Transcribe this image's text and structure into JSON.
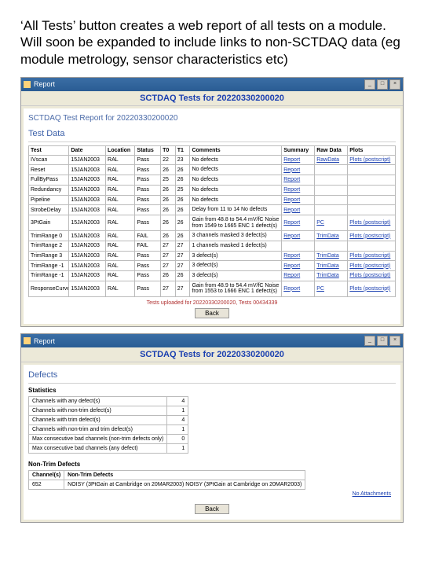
{
  "intro": "‘All Tests’ button creates a web report of all tests on a module. Will soon be expanded to include links to non-SCTDAQ data (eg module metrology, sensor characteristics etc)",
  "win1": {
    "titlebar": "Report",
    "header": "SCTDAQ Tests for 20220330200020",
    "subheader": "SCTDAQ Test Report for 20220330200020",
    "section": "Test Data",
    "cols": [
      "Test",
      "Date",
      "Location",
      "Status",
      "T0",
      "T1",
      "Comments",
      "Summary",
      "Raw Data",
      "Plots"
    ],
    "rows": [
      {
        "c": [
          "IVscan",
          "15JAN2003",
          "RAL",
          "Pass",
          "22",
          "23",
          "No defects",
          "Report",
          "RawData",
          "Plots (postscript)"
        ]
      },
      {
        "c": [
          "Reset",
          "15JAN2003",
          "RAL",
          "Pass",
          "26",
          "26",
          "No defects",
          "Report",
          "",
          ""
        ]
      },
      {
        "c": [
          "FullByPass",
          "15JAN2003",
          "RAL",
          "Pass",
          "25",
          "26",
          "No defects",
          "Report",
          "",
          ""
        ]
      },
      {
        "c": [
          "Redundancy",
          "15JAN2003",
          "RAL",
          "Pass",
          "26",
          "25",
          "No defects",
          "Report",
          "",
          ""
        ]
      },
      {
        "c": [
          "Pipeline",
          "15JAN2003",
          "RAL",
          "Pass",
          "26",
          "26",
          "No defects",
          "Report",
          "",
          ""
        ]
      },
      {
        "c": [
          "StrobeDelay",
          "15JAN2003",
          "RAL",
          "Pass",
          "26",
          "26",
          "Delay from 11 to 14\nNo defects",
          "Report",
          "",
          ""
        ]
      },
      {
        "c": [
          "3PtGain",
          "15JAN2003",
          "RAL",
          "Pass",
          "26",
          "26",
          "Gain from 48.8 to 54.4 mV/fC\nNoise from 1549 to 1665 ENC\n1 defect(s)",
          "Report",
          "PC",
          "Plots (postscript)"
        ]
      },
      {
        "c": [
          "TrimRange 0",
          "15JAN2003",
          "RAL",
          "FAIL",
          "26",
          "26",
          "3 channels masked\n3 defect(s)",
          "Report",
          "TrimData",
          "Plots (postscript)"
        ]
      },
      {
        "c": [
          "TrimRange 2",
          "15JAN2003",
          "RAL",
          "FAIL",
          "27",
          "27",
          "1 channels masked\n1 defect(s)",
          "",
          "",
          ""
        ]
      },
      {
        "c": [
          "TrimRange 3",
          "15JAN2003",
          "RAL",
          "Pass",
          "27",
          "27",
          "3 defect(s)",
          "Report",
          "TrimData",
          "Plots (postscript)"
        ]
      },
      {
        "c": [
          "TrimRange -1",
          "15JAN2003",
          "RAL",
          "Pass",
          "27",
          "27",
          "3 defect(s)",
          "Report",
          "TrimData",
          "Plots (postscript)"
        ]
      },
      {
        "c": [
          "TrimRange -1",
          "15JAN2003",
          "RAL",
          "Pass",
          "26",
          "26",
          "3 defect(s)",
          "Report",
          "TrimData",
          "Plots (postscript)"
        ]
      },
      {
        "c": [
          "ResponseCurve",
          "15JAN2003",
          "RAL",
          "Pass",
          "27",
          "27",
          "Gain from 48.9 to 54.4 mV/fC\nNoise from 1553 to 1666 ENC\n1 defect(s)",
          "Report",
          "PC",
          "Plots (postscript)"
        ]
      }
    ],
    "footnote": "Tests uploaded for 20220330200020, Tests 00434339",
    "back": "Back"
  },
  "win2": {
    "titlebar": "Report",
    "header": "SCTDAQ Tests for 20220330200020",
    "section": "Defects",
    "stats_label": "Statistics",
    "stats": [
      [
        "Channels with any defect(s)",
        "4"
      ],
      [
        "Channels with non-trim defect(s)",
        "1"
      ],
      [
        "Channels with trim defect(s)",
        "4"
      ],
      [
        "Channels with non-trim and trim defect(s)",
        "1"
      ],
      [
        "Max consecutive bad channels (non-trim defects only)",
        "0"
      ],
      [
        "Max consecutive bad channels (any defect)",
        "1"
      ]
    ],
    "nt_label": "Non-Trim Defects",
    "nt_cols": [
      "Channel(s)",
      "Non-Trim Defects"
    ],
    "nt_rows": [
      [
        "652",
        "NOISY (3PtGain at Cambridge on 20MAR2003)\nNOISY (3PtGain at Cambridge on 20MAR2003)"
      ]
    ],
    "noatt": "No Attachments",
    "back": "Back"
  }
}
